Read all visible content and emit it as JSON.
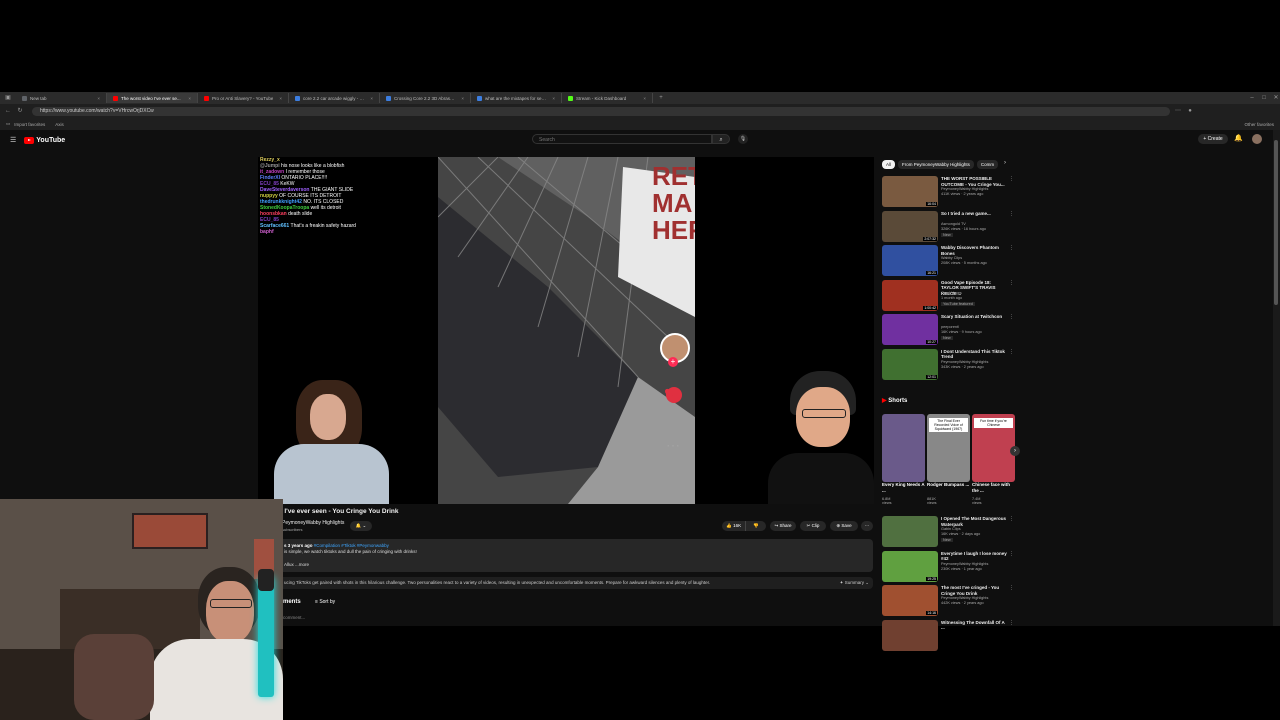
{
  "browser": {
    "tabs": [
      {
        "title": "New tab",
        "color": "#5f6368",
        "active": false
      },
      {
        "title": "The worst video I've ever se...",
        "color": "#ff0000",
        "active": true
      },
      {
        "title": "Pro or Anti Slavery? - YouTube",
        "color": "#ff0000",
        "active": false
      },
      {
        "title": "core 2.2 car arcade wiggly - Search",
        "color": "#3c7ee0",
        "active": false
      },
      {
        "title": "Crossing Core 2.2 3D Abrasion",
        "color": "#3c7ee0",
        "active": false
      },
      {
        "title": "what are the mixtapes for sex tal...",
        "color": "#3c7ee0",
        "active": false
      },
      {
        "title": "Stream - Kick Dashboard",
        "color": "#53fc18",
        "active": false
      }
    ],
    "url": "https://www.youtube.com/watch?v=VHrcwOrjDXCw",
    "bookmarks": [
      "Import favorites",
      "Axis"
    ],
    "other_favorites": "Other favorites"
  },
  "youtube": {
    "logo": "YouTube",
    "search_placeholder": "Search",
    "create_label": "Create"
  },
  "video": {
    "chat": [
      {
        "user": "Rezzy_x",
        "msg": "",
        "color": "#e0d060"
      },
      {
        "user": "@Jumpi",
        "msg": "his nose looks like a blobfish",
        "color": "#9a9a9a"
      },
      {
        "user": "it_zadown",
        "msg": "I remember those",
        "color": "#c040c0"
      },
      {
        "user": "FinderXI",
        "msg": "ONTARIO PLACE!!!!",
        "color": "#6080ff"
      },
      {
        "user": "ECU_85",
        "msg": "KeKW",
        "color": "#8040c0"
      },
      {
        "user": "DaveSteverdaverson",
        "msg": "THE GIANT SLIDE",
        "color": "#a060ff"
      },
      {
        "user": "nuppyy",
        "msg": "OF COURSE ITS DETROIT",
        "color": "#d0d040"
      },
      {
        "user": "thedrunkknight42",
        "msg": "NO. ITS CLOSED",
        "color": "#40a0ff"
      },
      {
        "user": "StonedKoopaTroopa",
        "msg": "well its detroit",
        "color": "#40d040"
      },
      {
        "user": "hoonsbkan",
        "msg": "death slide",
        "color": "#ff4060"
      },
      {
        "user": "ECU_85",
        "msg": "",
        "color": "#8040c0"
      },
      {
        "user": "Scarface661",
        "msg": "That's a freakin safety hazard",
        "color": "#60c0ff"
      },
      {
        "user": "baphf",
        "msg": "",
        "color": "#d060d0"
      }
    ],
    "sign_text": [
      "RET",
      "MA",
      "HER"
    ]
  },
  "watch": {
    "title": "st video I've ever seen - You Cringe You Drink",
    "channel": "PeymoneyWabby Highlights",
    "subscribers": "subscribers",
    "like_count": "16K",
    "share": "Share",
    "clip": "Clip",
    "save": "Save",
    "desc_meta": "s  3 years ago",
    "desc_tags": "#Compilation #Tiktok #Peymonwabby",
    "desc_line1": "is simple, we watch tiktoks and dull the pain of cringing with drinks!",
    "desc_more": "Allux ...more",
    "summary_text": "ucing TikToks get paired with shots in this hilarious challenge. Two personalities react to a variety of videos, resulting in unexpected and uncomfortable moments. Prepare for awkward silences and plenty of laughter.",
    "summary_label": "Summary",
    "comments_label": "ments",
    "sort_by": "Sort by",
    "add_comment": "comment..."
  },
  "sidebar": {
    "chips": [
      "All",
      "From PeymoneyWabby Highlights",
      "Comm"
    ],
    "recs": [
      {
        "title": "THE WORST POSSIBLE OUTCOME - You Cringe You...",
        "channel": "PeymoneyWabby Highlights",
        "meta": "411K views · 2 years ago",
        "badge": "",
        "duration": "16:04",
        "color": "#7a5a40"
      },
      {
        "title": "So I tried a new game...",
        "channel": "Asmongold TV",
        "meta": "326K views · 16 hours ago",
        "badge": "New",
        "duration": "2:07:32",
        "color": "#5a4a38"
      },
      {
        "title": "Wabby Discovers Phantom Bones",
        "channel": "Wabby Clips",
        "meta": "208K views · 5 months ago",
        "badge": "",
        "duration": "16:21",
        "color": "#3050a0"
      },
      {
        "title": "Good Vape Episode 18: TAYLOR SWIFT'S TRAVIS KELCE ...",
        "channel": "Good Vapes",
        "meta": "1 month ago",
        "badge": "YouTube featured",
        "duration": "1:00:42",
        "color": "#a03020"
      },
      {
        "title": "Scary Situation at Twitchcon",
        "channel": "peeporentl",
        "meta": "16K views · 9 hours ago",
        "badge": "New",
        "duration": "10:27",
        "color": "#7030a0"
      },
      {
        "title": "I Dont Understand This Tiktok Trend",
        "channel": "PeymoneyWabby Highlights",
        "meta": "343K views · 2 years ago",
        "badge": "",
        "duration": "12:01",
        "color": "#407030"
      }
    ],
    "shorts_label": "Shorts",
    "shorts": [
      {
        "title": "Every King Needs A ...",
        "views": "6.8M views",
        "caption": "",
        "color": "#6a5a8a"
      },
      {
        "title": "Rodger Bumpass ...",
        "views": "881K views",
        "caption": "The Final Ever Recorded Voice of Squidward (1967)",
        "color": "#888888"
      },
      {
        "title": "Chinese face with the ...",
        "views": "7.4M views",
        "caption": "Fun time if you're Chinese",
        "color": "#c04050"
      }
    ],
    "more_recs": [
      {
        "title": "I Opened The Most Dangerous Waterpark",
        "channel": "Gabin Clips",
        "meta": "16K views · 2 days ago",
        "badge": "New",
        "duration": "",
        "color": "#507040"
      },
      {
        "title": "Everytime I laugh I lose money #42",
        "channel": "PeymoneyWabby Highlights",
        "meta": "230K views · 1 year ago",
        "badge": "",
        "duration": "19:25",
        "color": "#60a040"
      },
      {
        "title": "The most I've cringed - You Cringe You Drink",
        "channel": "PeymoneyWabby Highlights",
        "meta": "442K views · 2 years ago",
        "badge": "",
        "duration": "14:16",
        "color": "#a05030"
      },
      {
        "title": "Witnessing The Downfall Of A ...",
        "channel": "",
        "meta": "",
        "badge": "",
        "duration": "",
        "color": "#704030"
      }
    ]
  }
}
